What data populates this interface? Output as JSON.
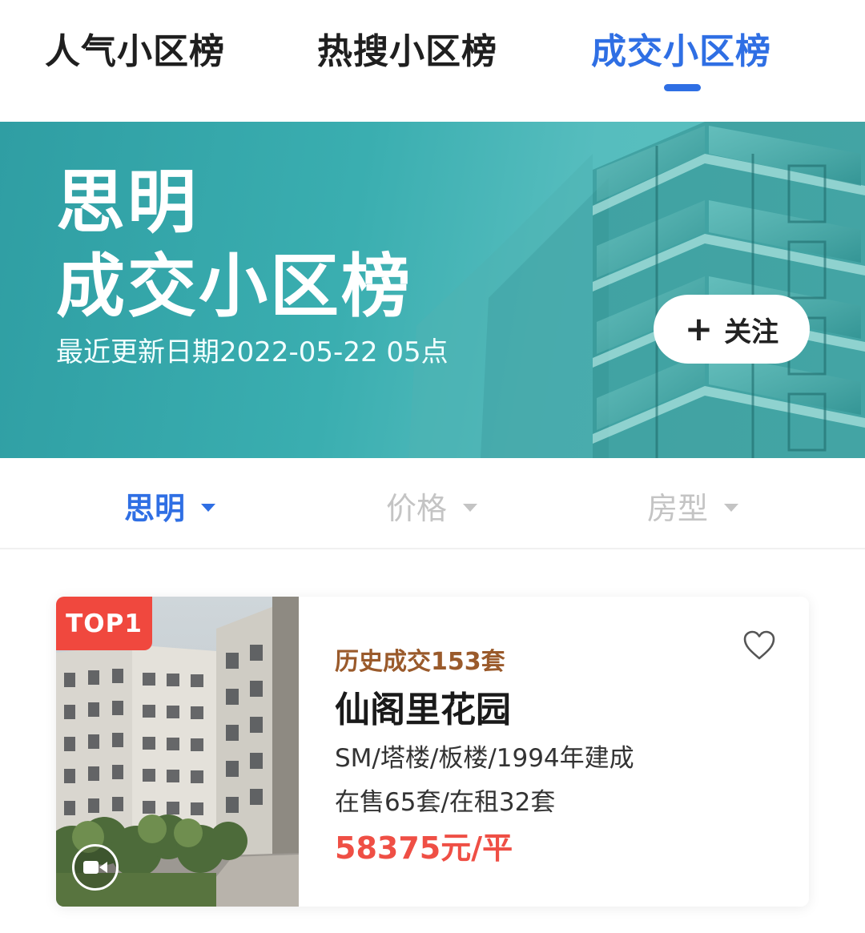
{
  "tabs": [
    {
      "label": "人气小区榜",
      "active": false
    },
    {
      "label": "热搜小区榜",
      "active": false
    },
    {
      "label": "成交小区榜",
      "active": true
    }
  ],
  "banner": {
    "district": "思明",
    "title": "成交小区榜",
    "update_text": "最近更新日期2022-05-22 05点",
    "follow_icon": "plus-icon",
    "follow_label": "关注"
  },
  "filters": [
    {
      "label": "思明",
      "active": true
    },
    {
      "label": "价格",
      "active": false
    },
    {
      "label": "房型",
      "active": false
    }
  ],
  "listing": {
    "rank_badge": "TOP1",
    "deals_text": "历史成交153套",
    "name": "仙阁里花园",
    "meta": "SM/塔楼/板楼/1994年建成",
    "supply": "在售65套/在租32套",
    "price": "58375元/平",
    "icons": [
      "video-icon",
      "heart-icon"
    ]
  },
  "colors": {
    "accent": "#2f6fe4",
    "banner": "#3aaeb0",
    "badge": "#f0483e",
    "price": "#ef4f45",
    "deals": "#9a5a2b"
  }
}
